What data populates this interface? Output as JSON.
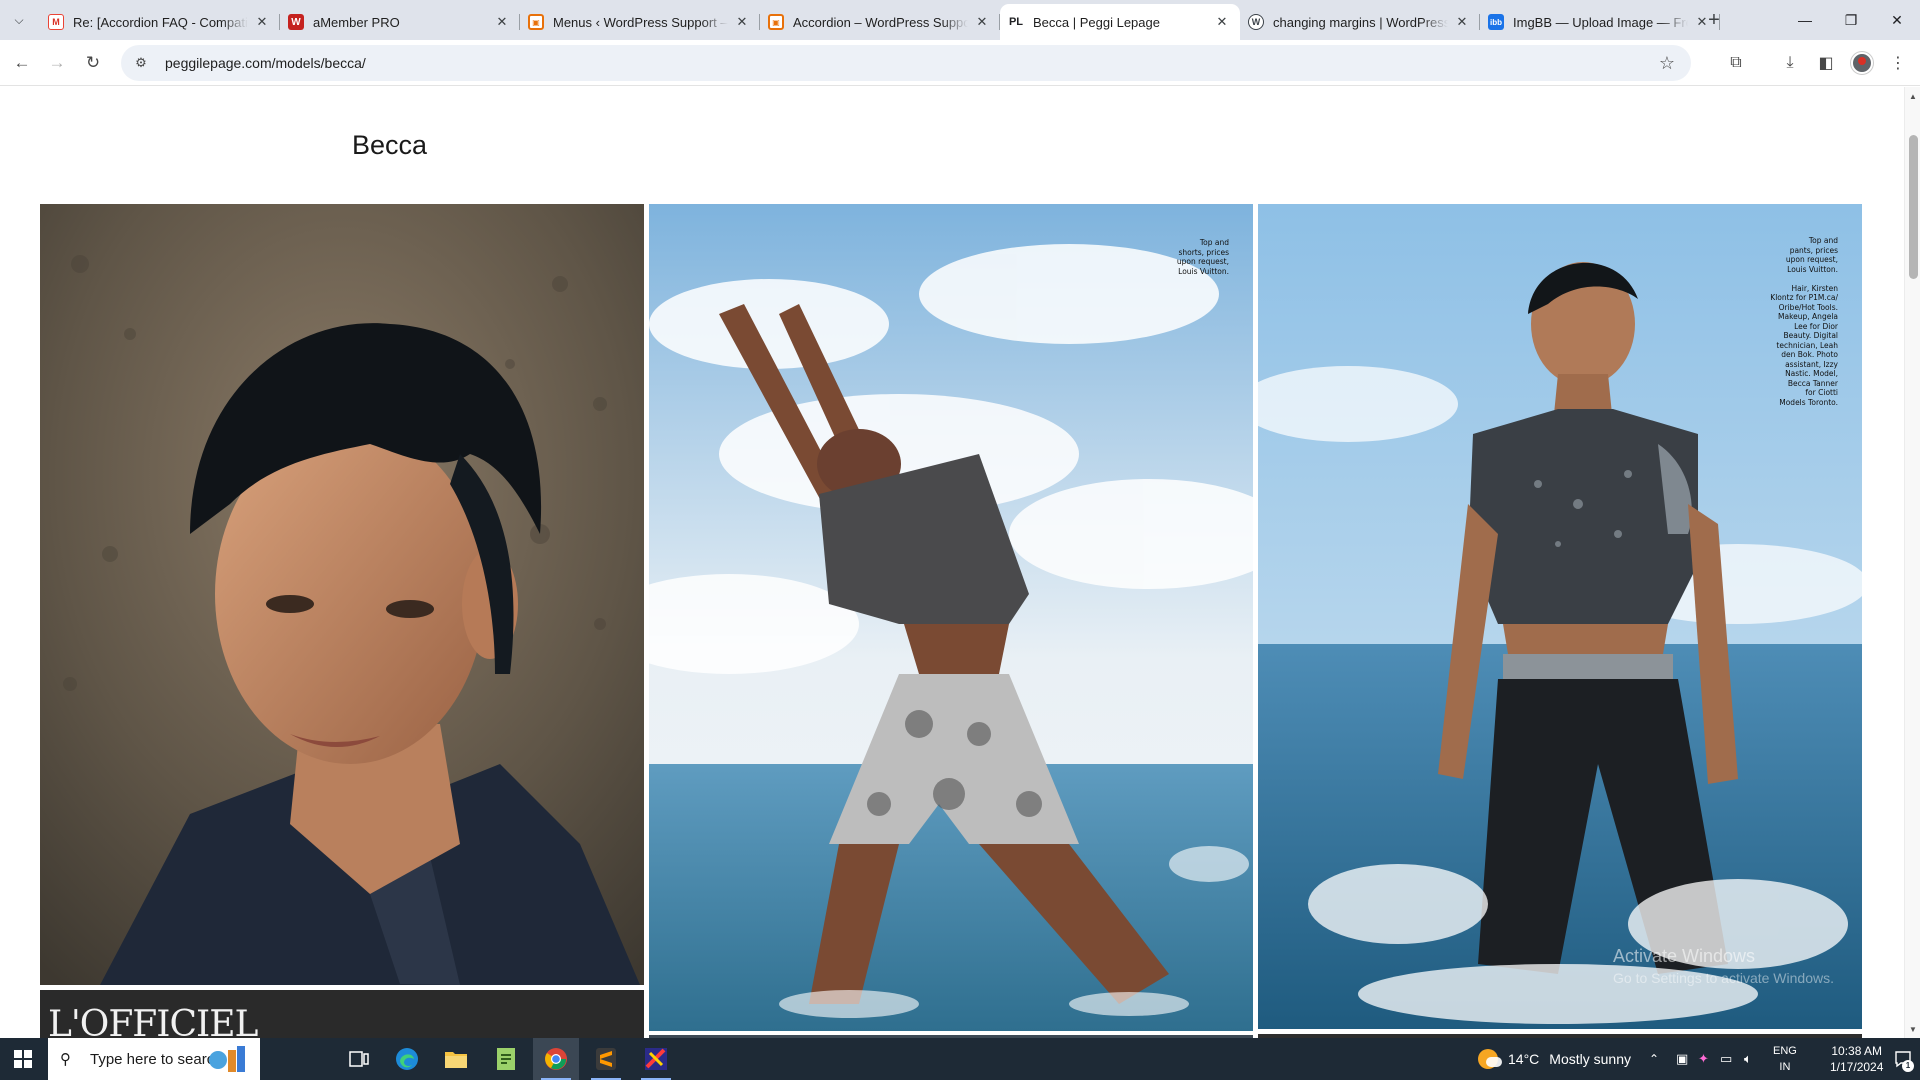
{
  "browser": {
    "tabs": [
      {
        "title": "Re: [Accordion FAQ - Compatib",
        "favicon": "gmail-icon"
      },
      {
        "title": "aMember PRO",
        "favicon": "amember-icon"
      },
      {
        "title": "Menus ‹ WordPress Support —",
        "favicon": "wp-dashboard-icon"
      },
      {
        "title": "Accordion – WordPress Suppor",
        "favicon": "wp-dashboard-icon"
      },
      {
        "title": "Becca | Peggi Lepage",
        "favicon": "pl-icon",
        "active": true
      },
      {
        "title": "changing margins | WordPress.",
        "favicon": "wordpress-icon"
      },
      {
        "title": "ImgBB — Upload Image — Free",
        "favicon": "imgbb-icon"
      }
    ],
    "url": "peggilepage.com/models/becca/"
  },
  "page": {
    "title": "Becca",
    "photos": [
      {
        "alt": "Close-up portrait of Becca on a pebble beach"
      },
      {
        "alt": "Becca stretching backward in the sea under a cloudy sky",
        "credit": "Top and\nshorts, prices\nupon request,\nLouis Vuitton."
      },
      {
        "alt": "Becca walking through splashing sea water",
        "credit": "Top and\npants, prices\nupon request,\nLouis Vuitton.\n\nHair, Kirsten\nKlontz for P1M.ca/\nOribe/Hot Tools.\nMakeup, Angela\nLee for Dior\nBeauty. Digital\ntechnician, Leah\nden Bok. Photo\nassistant, Izzy\nNastic. Model,\nBecca Tanner\nfor Ciotti\nModels Toronto."
      }
    ],
    "magazine": "L'OFFICIEL",
    "watermark_line1": "Activate Windows",
    "watermark_line2": "Go to Settings to activate Windows."
  },
  "taskbar": {
    "search_placeholder": "Type here to search",
    "weather": {
      "temp": "14°C",
      "condition": "Mostly sunny"
    },
    "lang": {
      "line1": "ENG",
      "line2": "IN"
    },
    "clock": {
      "time": "10:38 AM",
      "date": "1/17/2024"
    },
    "notifications": "1"
  },
  "colors": {
    "taskbar": "#1e2a36",
    "tab_strip": "#dfe3eb",
    "omnibox": "#edf1f7"
  }
}
